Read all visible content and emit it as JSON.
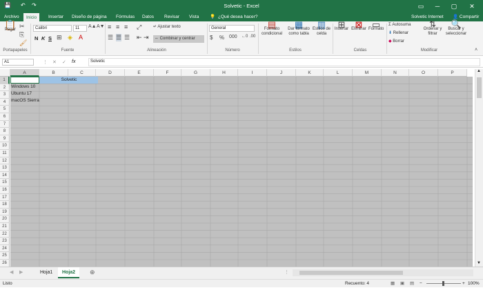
{
  "window": {
    "title": "Solvetic - Excel"
  },
  "qat": {
    "save": "💾",
    "undo": "↶",
    "redo": "↷"
  },
  "tabs": [
    "Archivo",
    "Inicio",
    "Insertar",
    "Diseño de página",
    "Fórmulas",
    "Datos",
    "Revisar",
    "Vista"
  ],
  "tell_me": "¿Qué desea hacer?",
  "user": "Solvetic Internet",
  "share": "Compartir",
  "ribbon": {
    "paste": "Pegar",
    "font_name": "Calibri",
    "font_size": "11",
    "wrap_text": "Ajustar texto",
    "merge_center": "Combinar y centrar",
    "number_format": "General",
    "cond_format": [
      "Formato",
      "condicional"
    ],
    "format_table": [
      "Dar formato",
      "como tabla"
    ],
    "cell_styles": [
      "Estilos de",
      "celda"
    ],
    "insert": "Insertar",
    "delete": "Eliminar",
    "format": "Formato",
    "autosum": "Autosuma",
    "fill": "Rellenar",
    "clear": "Borrar",
    "sort_filter": [
      "Ordenar y",
      "filtrar"
    ],
    "find_select": [
      "Buscar y",
      "seleccionar"
    ],
    "groups": {
      "clipboard": "Portapapeles",
      "font": "Fuente",
      "alignment": "Alineación",
      "number": "Número",
      "styles": "Estilos",
      "cells": "Celdas",
      "editing": "Modificar"
    },
    "bold": "N",
    "italic": "K",
    "underline": "S"
  },
  "formula_bar": {
    "namebox": "A1",
    "fx": "fx",
    "content": "Solvetic"
  },
  "columns": [
    "A",
    "B",
    "C",
    "D",
    "E",
    "F",
    "G",
    "H",
    "I",
    "J",
    "K",
    "L",
    "M",
    "N",
    "O",
    "P"
  ],
  "rows": [
    "1",
    "2",
    "3",
    "4",
    "5",
    "6",
    "7",
    "8",
    "9",
    "10",
    "11",
    "12",
    "13",
    "14",
    "15",
    "16",
    "17",
    "18",
    "19",
    "20",
    "21",
    "22",
    "23",
    "24",
    "25",
    "26"
  ],
  "cells": {
    "B1": "Solvetic",
    "A2": "Windows 10",
    "A3": "Ubuntu 17",
    "A4": "macOS Sierra"
  },
  "sheets": [
    {
      "name": "Hoja1",
      "active": false
    },
    {
      "name": "Hoja2",
      "active": true
    }
  ],
  "status": {
    "mode": "Listo",
    "count": "Recuento: 4",
    "zoom": "100%"
  }
}
